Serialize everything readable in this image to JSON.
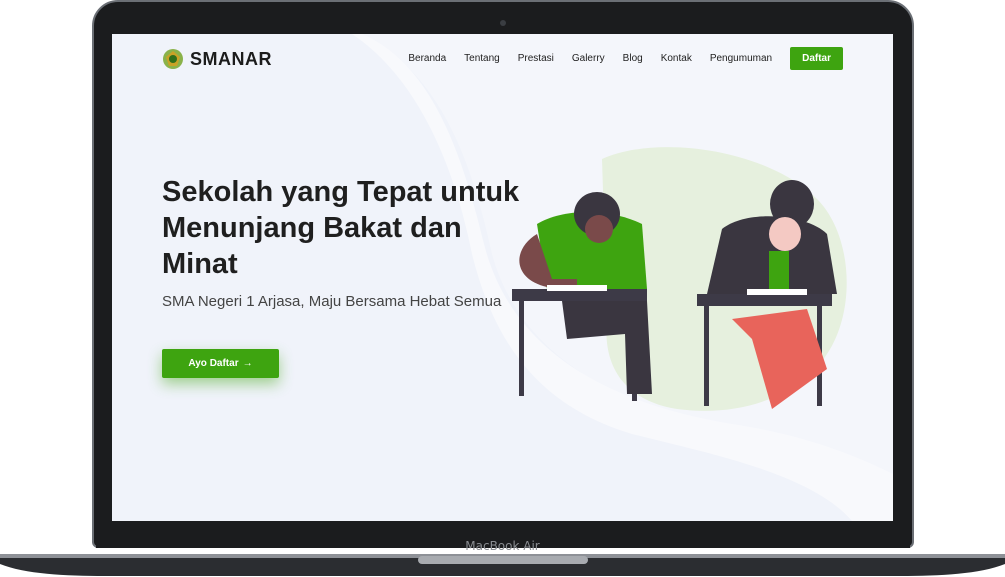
{
  "site": {
    "brand": "SMANAR",
    "nav": [
      "Beranda",
      "Tentang",
      "Prestasi",
      "Galerry",
      "Blog",
      "Kontak",
      "Pengumuman"
    ],
    "nav_cta": "Daftar",
    "hero_title": "Sekolah yang Tepat untuk Menunjang Bakat dan Minat",
    "hero_subtitle": "SMA Negeri 1 Arjasa, Maju Bersama Hebat Semua",
    "hero_cta": "Ayo Daftar",
    "hero_cta_icon": "arrow-right-icon"
  },
  "device": {
    "label": "MacBook Air"
  },
  "colors": {
    "accent": "#3ea410",
    "text": "#1f1f1f",
    "background": "#f4f6fb",
    "bezel": "#1b1c1e"
  }
}
